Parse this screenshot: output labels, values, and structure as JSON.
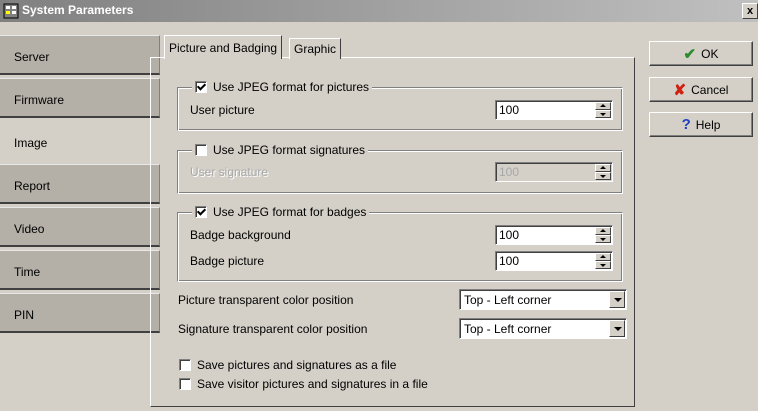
{
  "window": {
    "title": "System Parameters",
    "close_glyph": "x"
  },
  "sidebar": {
    "items": [
      {
        "label": "Server"
      },
      {
        "label": "Firmware"
      },
      {
        "label": "Image"
      },
      {
        "label": "Report"
      },
      {
        "label": "Video"
      },
      {
        "label": "Time"
      },
      {
        "label": "PIN"
      }
    ]
  },
  "tabs": [
    {
      "label": "Picture and Badging"
    },
    {
      "label": "Graphic"
    }
  ],
  "pictures": {
    "checkbox_label": "Use JPEG format for pictures",
    "checked": true,
    "user_picture_label": "User picture",
    "user_picture_value": "100"
  },
  "signatures": {
    "checkbox_label": "Use JPEG format signatures",
    "checked": false,
    "user_signature_label": "User signature",
    "user_signature_value": "100"
  },
  "badges": {
    "checkbox_label": "Use JPEG format for badges",
    "checked": true,
    "background_label": "Badge background",
    "background_value": "100",
    "picture_label": "Badge picture",
    "picture_value": "100"
  },
  "transparency": {
    "picture_label": "Picture transparent color position",
    "picture_value": "Top - Left corner",
    "signature_label": "Signature transparent color position",
    "signature_value": "Top - Left corner"
  },
  "options": {
    "save_as_file_label": "Save pictures and signatures as a file",
    "save_as_file_checked": false,
    "save_visitor_label": "Save visitor pictures and signatures in a file",
    "save_visitor_checked": false
  },
  "buttons": {
    "ok_label": "OK",
    "ok_icon": "checkmark-icon",
    "cancel_label": "Cancel",
    "cancel_icon": "x-icon",
    "help_label": "Help",
    "help_icon": "question-icon"
  },
  "colors": {
    "ok_icon": "#2e8b2e",
    "cancel_icon": "#d02010",
    "help_icon": "#2040c0"
  }
}
